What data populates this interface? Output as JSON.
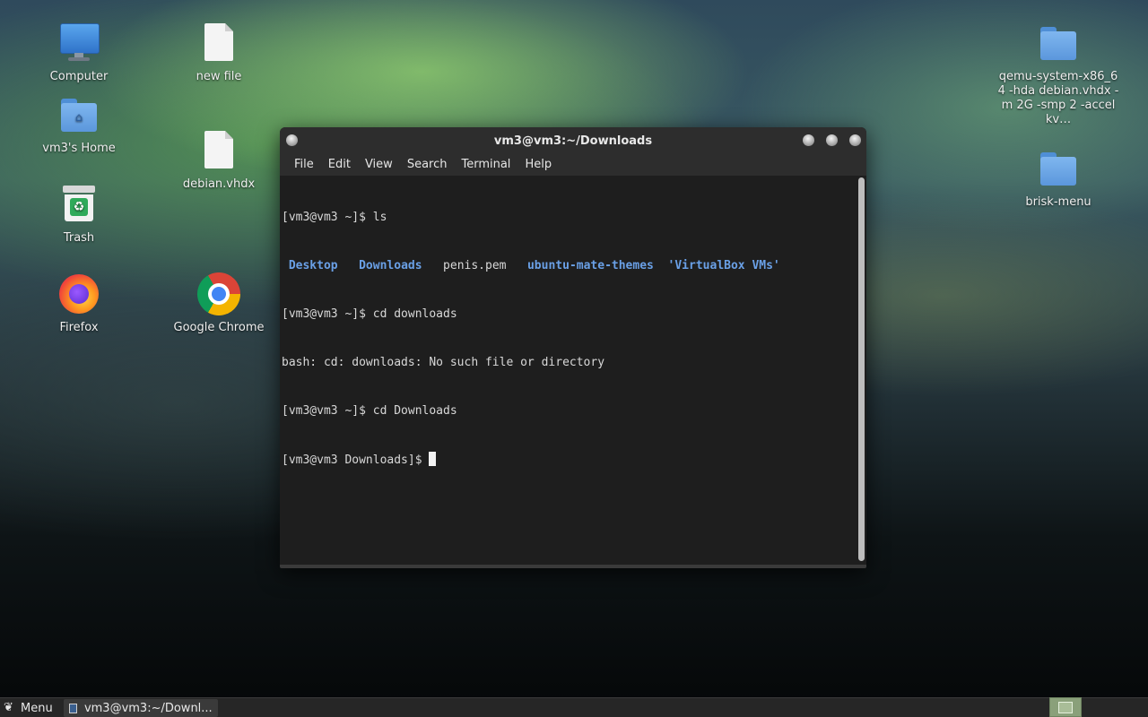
{
  "desktop": {
    "icons": [
      {
        "label": "Computer",
        "icon": "computer-icon"
      },
      {
        "label": "new file",
        "icon": "file-icon"
      },
      {
        "label": "vm3's Home",
        "icon": "home-folder-icon"
      },
      {
        "label": "debian.vhdx",
        "icon": "file-icon"
      },
      {
        "label": "Trash",
        "icon": "trash-icon"
      },
      {
        "label": "Firefox",
        "icon": "firefox-icon"
      },
      {
        "label": "Google Chrome",
        "icon": "chrome-icon"
      },
      {
        "label": "qemu-system-x86_64 -hda debian.vhdx -m 2G -smp 2 -accel kv…",
        "icon": "folder-icon"
      },
      {
        "label": "brisk-menu",
        "icon": "folder-icon"
      }
    ]
  },
  "terminal": {
    "title": "vm3@vm3:~/Downloads",
    "menu": [
      "File",
      "Edit",
      "View",
      "Search",
      "Terminal",
      "Help"
    ],
    "lines": {
      "l1": "[vm3@vm3 ~]$ ls",
      "ls_items": [
        "Desktop",
        "Downloads",
        "penis.pem",
        "ubuntu-mate-themes",
        "'VirtualBox VMs'"
      ],
      "l3": "[vm3@vm3 ~]$ cd downloads",
      "l4": "bash: cd: downloads: No such file or directory",
      "l5": "[vm3@vm3 ~]$ cd Downloads",
      "l6": "[vm3@vm3 Downloads]$ "
    }
  },
  "taskbar": {
    "menu_label": "Menu",
    "task_label": "vm3@vm3:~/Downl..."
  },
  "colors": {
    "directory": "#6aa0e6",
    "terminal_bg": "#1e1e1e",
    "taskbar_bg": "#262626"
  }
}
